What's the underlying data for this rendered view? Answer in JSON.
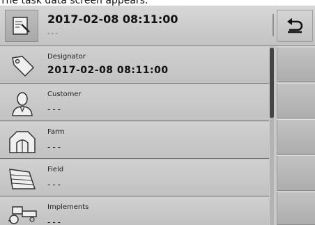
{
  "caption": "The task data screen appears:",
  "header": {
    "title": "2017-02-08 08:11:00",
    "subtitle": "---",
    "icon": "task-document-icon",
    "back_icon": "return-arrow-icon"
  },
  "rows": [
    {
      "label": "Designator",
      "value": "2017-02-08 08:11:00",
      "icon": "tag-icon"
    },
    {
      "label": "Customer",
      "value": "---",
      "icon": "person-icon"
    },
    {
      "label": "Farm",
      "value": "---",
      "icon": "barn-icon"
    },
    {
      "label": "Field",
      "value": "---",
      "icon": "field-icon"
    },
    {
      "label": "Implements",
      "value": "---",
      "icon": "tractor-icon"
    }
  ]
}
